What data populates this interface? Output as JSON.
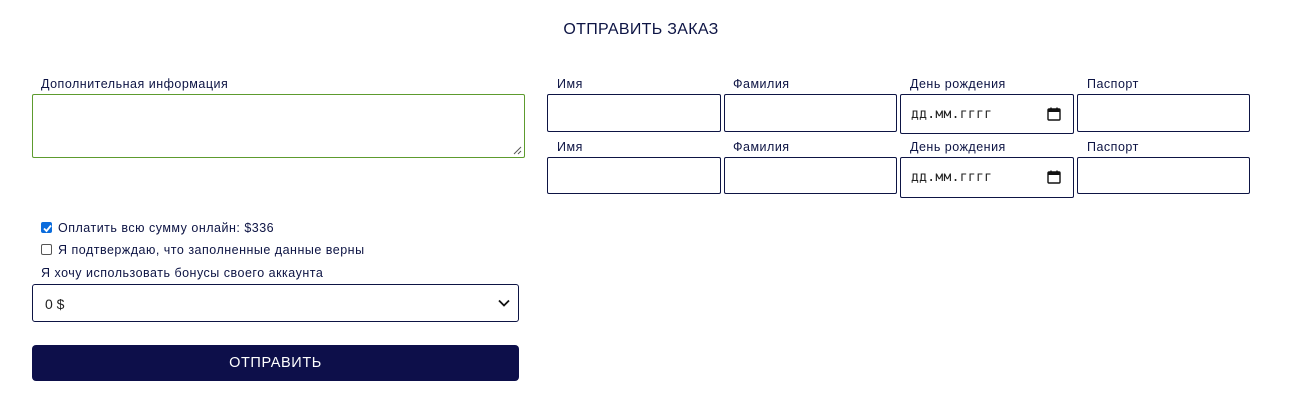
{
  "page": {
    "title": "ОТПРАВИТЬ ЗАКАЗ"
  },
  "notes": {
    "label": "Дополнительная информация",
    "value": ""
  },
  "passengers": [
    {
      "first_name_label": "Имя",
      "last_name_label": "Фамилия",
      "birthday_label": "День рождения",
      "birthday_placeholder": "дд.мм.гггг",
      "passport_label": "Паспорт"
    },
    {
      "first_name_label": "Имя",
      "last_name_label": "Фамилия",
      "birthday_label": "День рождения",
      "birthday_placeholder": "дд.мм.гггг",
      "passport_label": "Паспорт"
    }
  ],
  "options": {
    "pay_online": {
      "label": "Оплатить всю сумму онлайн: $336",
      "checked": true
    },
    "confirm_data": {
      "label": "Я подтверждаю, что заполненные данные верны",
      "checked": false
    }
  },
  "bonuses": {
    "label": "Я хочу использовать бонусы своего аккаунта",
    "selected": "0 $"
  },
  "submit": {
    "label": "ОТПРАВИТЬ"
  },
  "colors": {
    "accent": "#0d0f4a",
    "text": "#0d1444",
    "notes_border": "#5d9b2e",
    "checkbox": "#0b6cdc"
  },
  "icons": {
    "date": "calendar-icon",
    "select": "chevron-down-icon",
    "check": "checkmark-icon"
  }
}
